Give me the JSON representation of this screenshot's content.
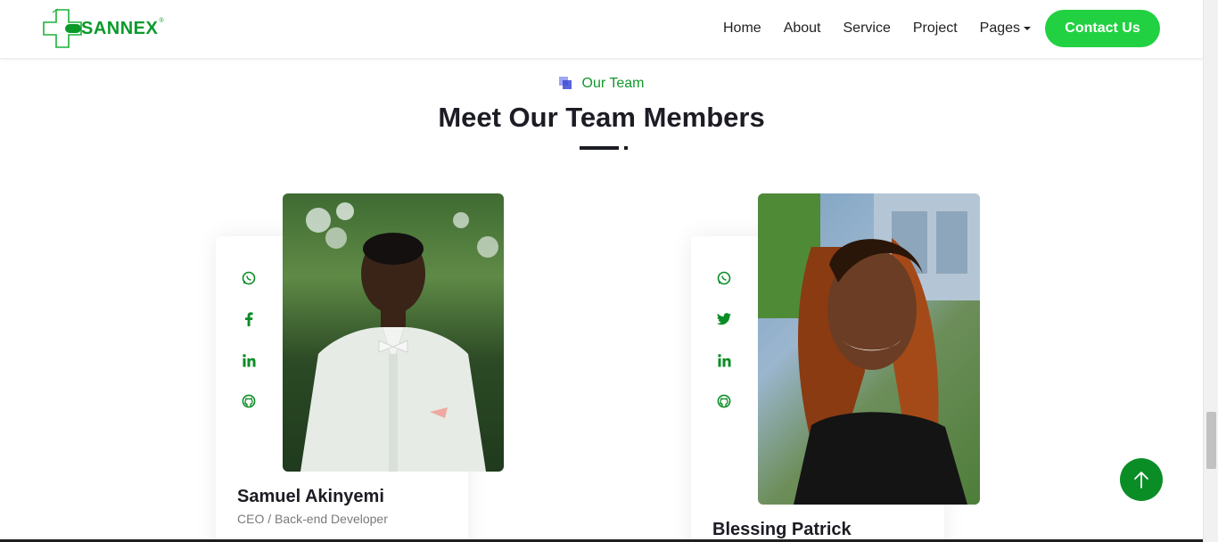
{
  "brand": {
    "name": "SANNEX",
    "reg": "®",
    "accent": "#22d142",
    "primary": "#0b8d26"
  },
  "nav": {
    "items": [
      "Home",
      "About",
      "Service",
      "Project"
    ],
    "pages_label": "Pages",
    "contact_label": "Contact Us"
  },
  "section": {
    "subtitle": "Our Team",
    "title": "Meet Our Team Members"
  },
  "members": [
    {
      "name": "Samuel Akinyemi",
      "role": "CEO / Back-end Developer",
      "socials": [
        "whatsapp-icon",
        "facebook-icon",
        "linkedin-icon",
        "github-icon"
      ]
    },
    {
      "name": "Blessing Patrick",
      "role": "",
      "socials": [
        "whatsapp-icon",
        "twitter-icon",
        "linkedin-icon",
        "github-icon"
      ]
    }
  ],
  "icons": {
    "back_to_top": "arrow-up-icon"
  }
}
